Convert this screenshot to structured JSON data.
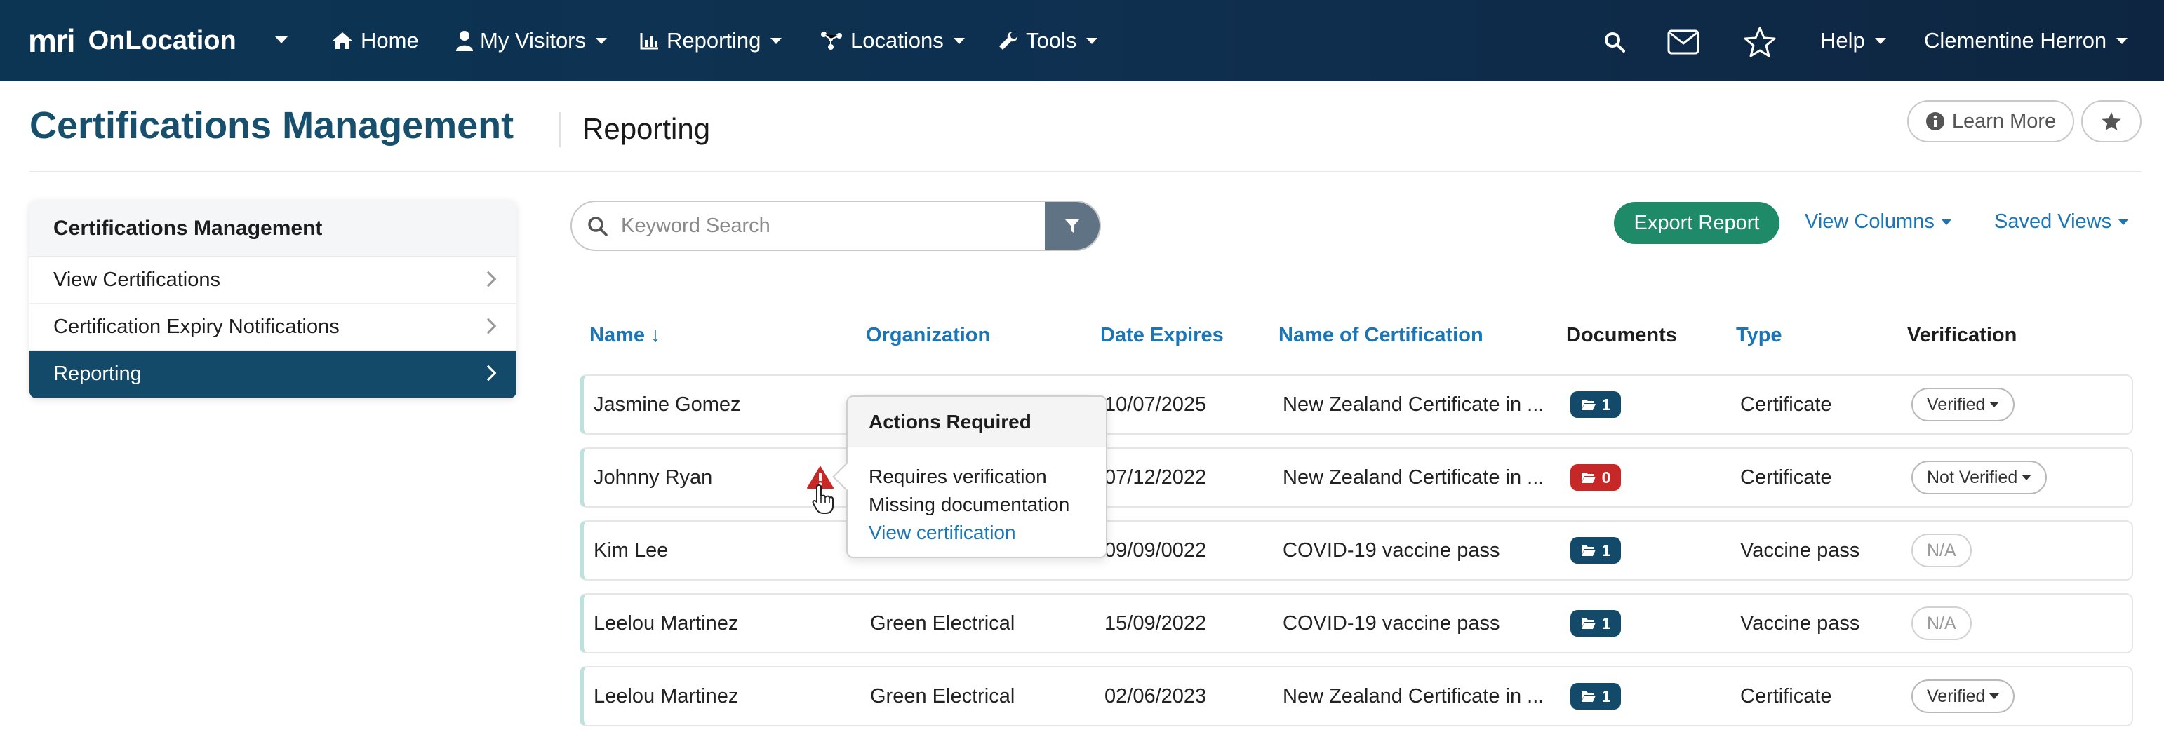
{
  "nav": {
    "brand_logo": "mri",
    "brand_name": "OnLocation",
    "items": [
      {
        "label": "Home",
        "icon": "home-icon"
      },
      {
        "label": "My Visitors",
        "icon": "user-icon"
      },
      {
        "label": "Reporting",
        "icon": "bar-chart-icon"
      },
      {
        "label": "Locations",
        "icon": "network-icon"
      },
      {
        "label": "Tools",
        "icon": "wrench-icon"
      }
    ],
    "help_label": "Help",
    "user_name": "Clementine Herron"
  },
  "header": {
    "title": "Certifications Management",
    "subtitle": "Reporting",
    "learn_more_label": "Learn More"
  },
  "sidebar": {
    "heading": "Certifications Management",
    "items": [
      {
        "label": "View Certifications",
        "active": false
      },
      {
        "label": "Certification Expiry Notifications",
        "active": false
      },
      {
        "label": "Reporting",
        "active": true
      }
    ]
  },
  "toolbar": {
    "search_placeholder": "Keyword Search",
    "export_label": "Export Report",
    "view_columns_label": "View Columns",
    "saved_views_label": "Saved Views"
  },
  "table": {
    "columns": [
      {
        "label": "Name ↓",
        "sortable": true
      },
      {
        "label": "Organization",
        "sortable": true
      },
      {
        "label": "Date Expires",
        "sortable": true
      },
      {
        "label": "Name of Certification",
        "sortable": true
      },
      {
        "label": "Documents",
        "sortable": false
      },
      {
        "label": "Type",
        "sortable": true
      },
      {
        "label": "Verification",
        "sortable": false
      }
    ],
    "rows": [
      {
        "name": "Jasmine Gomez",
        "organization": "",
        "date_expires": "10/07/2025",
        "certification": "New Zealand Certificate in ...",
        "documents": "1",
        "type": "Certificate",
        "verification": "Verified"
      },
      {
        "name": "Johnny Ryan",
        "organization": "",
        "date_expires": "07/12/2022",
        "certification": "New Zealand Certificate in ...",
        "documents": "0",
        "type": "Certificate",
        "verification": "Not Verified"
      },
      {
        "name": "Kim Lee",
        "organization": "",
        "date_expires": "09/09/0022",
        "certification": "COVID-19 vaccine pass",
        "documents": "1",
        "type": "Vaccine pass",
        "verification": "N/A"
      },
      {
        "name": "Leelou Martinez",
        "organization": "Green Electrical",
        "date_expires": "15/09/2022",
        "certification": "COVID-19 vaccine pass",
        "documents": "1",
        "type": "Vaccine pass",
        "verification": "N/A"
      },
      {
        "name": "Leelou Martinez",
        "organization": "Green Electrical",
        "date_expires": "02/06/2023",
        "certification": "New Zealand Certificate in ...",
        "documents": "1",
        "type": "Certificate",
        "verification": "Verified"
      }
    ]
  },
  "popover": {
    "title": "Actions Required",
    "lines": [
      "Requires verification",
      "Missing documentation"
    ],
    "link_label": "View certification"
  },
  "colors": {
    "nav_bg": "#0c3553",
    "title_color": "#174f6d",
    "accent_link": "#1a76b6",
    "export_green": "#1f8a67",
    "sidebar_active": "#134a69",
    "badge_danger": "#c62828"
  }
}
